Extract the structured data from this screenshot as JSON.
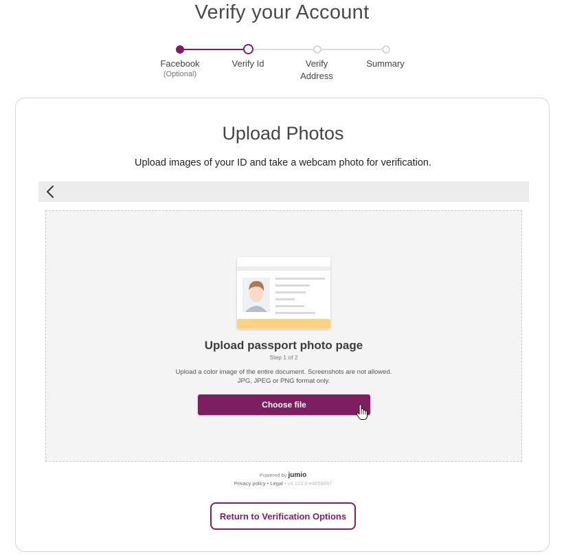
{
  "header": {
    "title": "Verify your Account"
  },
  "stepper": {
    "steps": [
      {
        "label": "Facebook",
        "sublabel": "(Optional)",
        "state": "done"
      },
      {
        "label": "Verify Id",
        "state": "current"
      },
      {
        "label": "Verify Address",
        "state": "pending"
      },
      {
        "label": "Summary",
        "state": "pending"
      }
    ]
  },
  "card": {
    "title": "Upload Photos",
    "subtitle": "Upload images of your ID and take a webcam photo for verification.",
    "back_icon": "chevron-left-icon",
    "upload": {
      "title": "Upload passport photo page",
      "step": "Step 1 of 2",
      "description": "Upload a color image of the entire document. Screenshots are not allowed. JPG, JPEG or PNG format only.",
      "button": "Choose file"
    },
    "footer": {
      "powered_by": "Powered by",
      "brand": "jumio",
      "privacy": "Privacy policy",
      "separator": "•",
      "legal": "Legal",
      "version": "v4.122.0-e4658697"
    },
    "return_button": "Return to Verification Options"
  },
  "colors": {
    "accent": "#7e1e62",
    "card_border": "#d4d4d4",
    "upload_bg": "#f4f4f4",
    "nav_bg": "#ececec"
  }
}
